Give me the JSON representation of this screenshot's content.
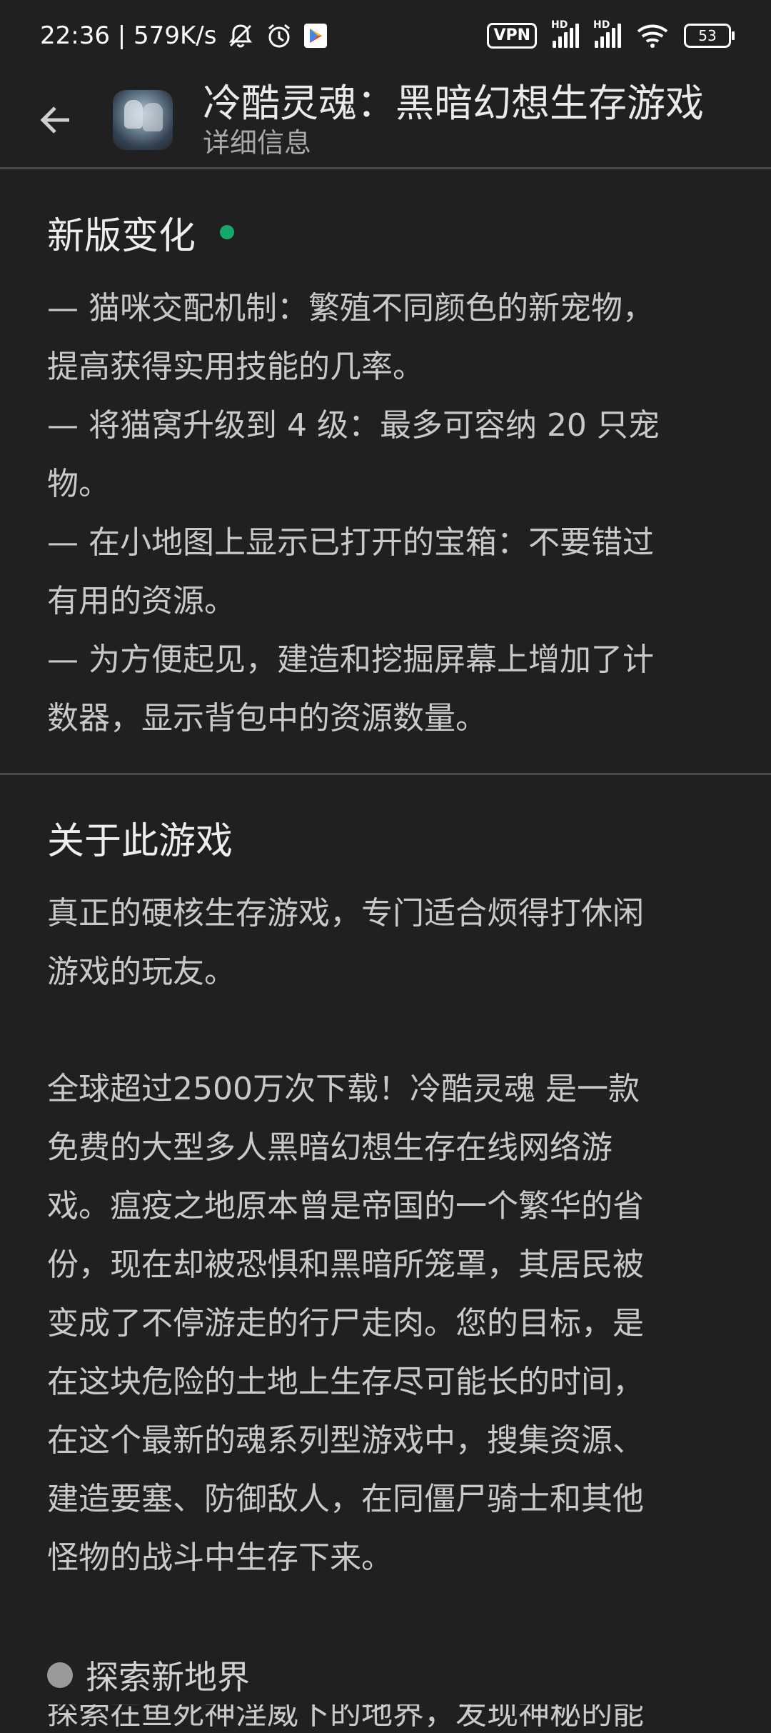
{
  "status_bar": {
    "time_speed": "22:36 | 579K/s",
    "icons": [
      "bell-muted-icon",
      "alarm-icon",
      "play-store-icon",
      "vpn-icon",
      "hd-signal-icon",
      "wifi-icon",
      "battery-icon"
    ],
    "vpn_label": "VPN",
    "hd_label": "HD",
    "battery_level": "53"
  },
  "header": {
    "title": "冷酷灵魂：黑暗幻想生存游戏",
    "subtitle": "详细信息",
    "back_icon": "arrow-left-icon",
    "app_icon": "game-app-icon"
  },
  "whats_new": {
    "title": "新版变化",
    "dot_color": "#15a86b",
    "lines": [
      "— 猫咪交配机制：繁殖不同颜色的新宠物，",
      "提高获得实用技能的几率。",
      "— 将猫窝升级到 4 级：最多可容纳 20 只宠",
      "物。",
      "— 在小地图上显示已打开的宝箱：不要错过",
      "有用的资源。",
      "— 为方便起见，建造和挖掘屏幕上增加了计",
      "数器，显示背包中的资源数量。"
    ]
  },
  "about": {
    "title": "关于此游戏",
    "para1": [
      "真正的硬核生存游戏，专门适合烦得打休闲",
      "游戏的玩友。"
    ],
    "para2": [
      "全球超过2500万次下载！冷酷灵魂 是一款",
      "免费的大型多人黑暗幻想生存在线网络游",
      "戏。瘟疫之地原本曾是帝国的一个繁华的省",
      "份，现在却被恐惧和黑暗所笼罩，其居民被",
      "变成了不停游走的行尸走肉。您的目标，是",
      "在这块危险的土地上生存尽可能长的时间，",
      "在这个最新的魂系列型游戏中，搜集资源、",
      "建造要塞、防御敌人，在同僵尸骑士和其他",
      "怪物的战斗中生存下来。"
    ],
    "bullet": "探索新地界",
    "clipped": "探索在鱼死神淫威下的地界，发现神秘的能"
  }
}
